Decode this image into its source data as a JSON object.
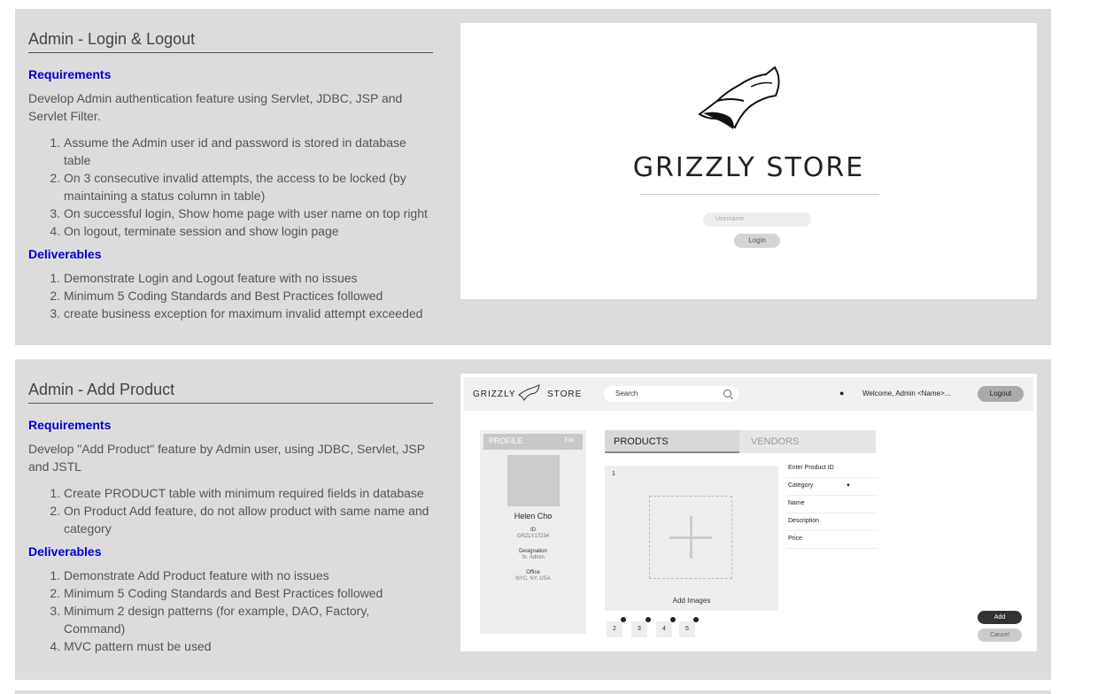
{
  "sections": [
    {
      "title": "Admin - Login & Logout",
      "requirements_heading": "Requirements",
      "description": "Develop Admin authentication feature using Servlet, JDBC, JSP and Servlet Filter.",
      "requirements": [
        "Assume the Admin user id and password is stored in database table",
        "On 3 consecutive invalid attempts, the access to be locked (by maintaining a status column in table)",
        "On successful login, Show home page with user name on top right",
        "On logout, terminate session and show login page"
      ],
      "deliverables_heading": "Deliverables",
      "deliverables": [
        "Demonstrate Login and Logout feature with no issues",
        "Minimum 5 Coding Standards and Best Practices followed",
        "create business exception for maximum invalid attempt exceeded"
      ]
    },
    {
      "title": "Admin - Add Product",
      "requirements_heading": "Requirements",
      "description": "Develop \"Add Product\" feature by Admin user, using JDBC, Servlet, JSP and JSTL",
      "requirements": [
        "Create PRODUCT table with minimum required fields in database",
        "On Product Add feature, do not allow product with same name and category"
      ],
      "deliverables_heading": "Deliverables",
      "deliverables": [
        "Demonstrate Add Product feature with no issues",
        "Minimum 5 Coding Standards and Best Practices followed",
        "Minimum 2 design patterns (for example, DAO, Factory, Command)",
        "MVC pattern must be used"
      ]
    }
  ],
  "login_mock": {
    "brand": "GRIZZLY STORE",
    "username_placeholder": "Username",
    "login_label": "Login",
    "logo_icon": "wolf-head-icon"
  },
  "product_mock": {
    "brand_left": "GRIZZLY",
    "brand_right": "STORE",
    "search_placeholder": "Search",
    "welcome": "Welcome, Admin <Name>...",
    "logout_label": "Logout",
    "profile": {
      "title": "PROFILE",
      "edit": "Edit",
      "name": "Helen Cho",
      "id_label": "ID",
      "id_value": "GRZLY17234",
      "designation_label": "Designation",
      "designation_value": "Sr. Admin",
      "office_label": "Office",
      "office_value": "NYC, NY, USA"
    },
    "tabs": [
      "PRODUCTS",
      "VENDORS"
    ],
    "image_index": "1",
    "add_images": "Add Images",
    "thumbnails": [
      "2",
      "3",
      "4",
      "5"
    ],
    "fields": [
      "Enter Product ID",
      "Category",
      "Name",
      "Description",
      "Price"
    ],
    "add_label": "Add",
    "cancel_label": "Cancel"
  },
  "colors": {
    "panel_bg": "#dcdcdc",
    "heading_blue": "#0000cc"
  }
}
